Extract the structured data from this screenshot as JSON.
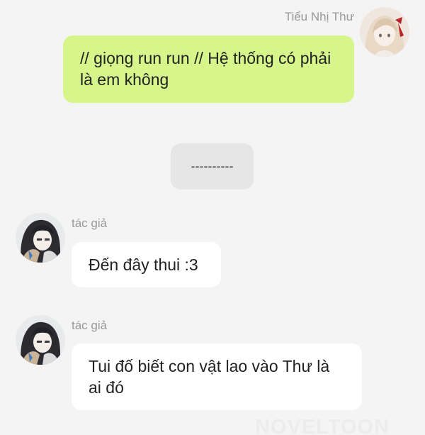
{
  "messages": [
    {
      "sender": "Tiểu Nhị Thư",
      "side": "right",
      "avatar_icon": "avatar-girl-red-ribbon-icon",
      "text": "// giọng run run // Hệ thống có phải là em không"
    },
    {
      "type": "separator",
      "text": "----------"
    },
    {
      "sender": "tác giả",
      "side": "left",
      "avatar_icon": "avatar-author-icon",
      "text": "Đến đây thui :3"
    },
    {
      "sender": "tác giả",
      "side": "left",
      "avatar_icon": "avatar-author-icon",
      "text": "Tui đố biết con vật lao vào Thư là ai đó"
    }
  ],
  "watermark": "NOVELTOON",
  "colors": {
    "background": "#f4f4f4",
    "my_bubble": "#d6f58b",
    "their_bubble": "#ffffff",
    "separator_box": "#e6e6e6",
    "sender_name": "#999999"
  }
}
